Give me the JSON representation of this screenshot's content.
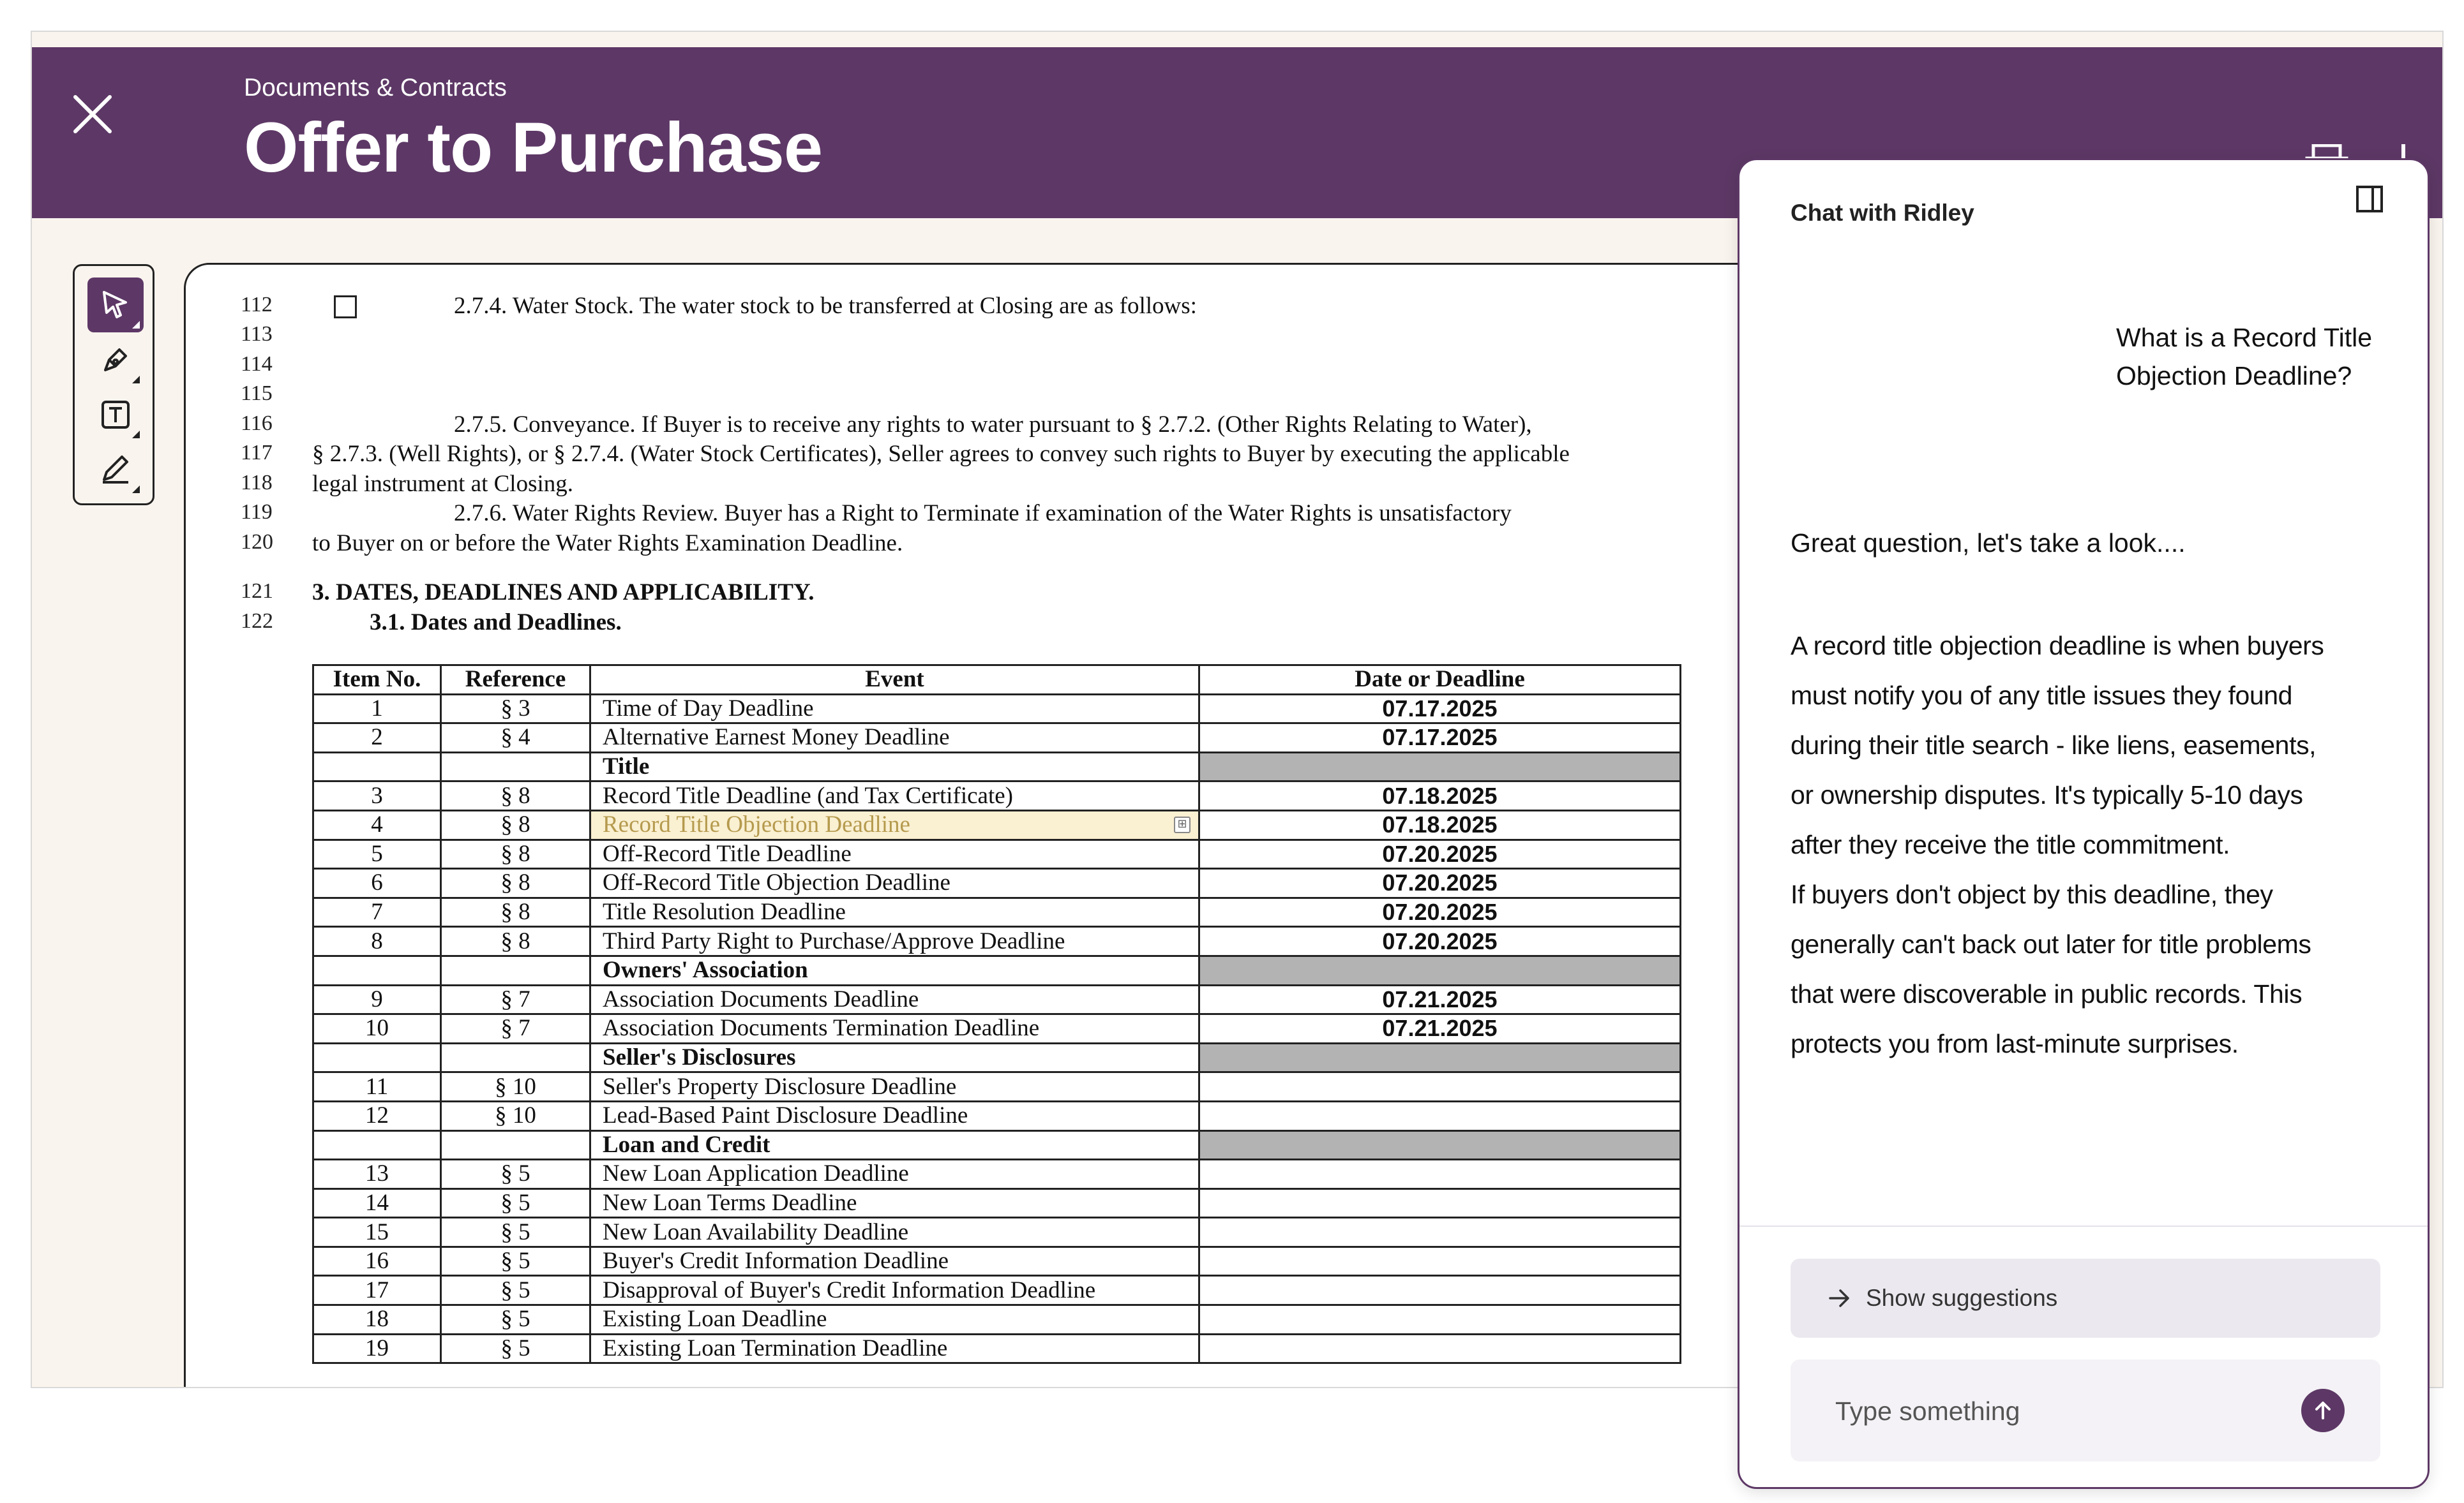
{
  "header": {
    "breadcrumb": "Documents & Contracts",
    "title": "Offer to Purchase"
  },
  "toolbar": {
    "tools": [
      "select-tool",
      "pen-tool",
      "text-tool",
      "highlight-tool"
    ],
    "active": "select-tool"
  },
  "document": {
    "lines": [
      {
        "num": "112",
        "text": "2.7.4.    Water Stock.  The water stock to be transferred at Closing are as follows:"
      },
      {
        "num": "113",
        "text": ""
      },
      {
        "num": "114",
        "text": ""
      },
      {
        "num": "115",
        "text": ""
      },
      {
        "num": "116",
        "text": "2.7.5.    Conveyance.  If Buyer is to receive any rights to water pursuant to § 2.7.2. (Other Rights Relating to Water),"
      },
      {
        "num": "117",
        "text": "§ 2.7.3. (Well Rights), or § 2.7.4. (Water Stock Certificates), Seller agrees to convey such rights to Buyer by executing the applicable"
      },
      {
        "num": "118",
        "text": "legal instrument at Closing."
      },
      {
        "num": "119",
        "text": "2.7.6.    Water Rights Review.  Buyer has a Right to Terminate if examination of the Water Rights is unsatisfactory"
      },
      {
        "num": "120",
        "text": "to Buyer on or before the Water Rights Examination Deadline."
      },
      {
        "num": "121",
        "text": "3.    DATES, DEADLINES AND APPLICABILITY."
      },
      {
        "num": "122",
        "text": "3.1.    Dates and Deadlines."
      }
    ],
    "table": {
      "headers": [
        "Item No.",
        "Reference",
        "Event",
        "Date or Deadline"
      ],
      "rows": [
        {
          "item": "1",
          "ref": "§ 3",
          "event": "Time of Day Deadline",
          "date": "07.17.2025"
        },
        {
          "item": "2",
          "ref": "§ 4",
          "event": "Alternative Earnest Money Deadline",
          "date": "07.17.2025"
        },
        {
          "item": "",
          "ref": "",
          "event": "Title",
          "date": "",
          "section": true
        },
        {
          "item": "3",
          "ref": "§ 8",
          "event": "Record Title Deadline (and Tax Certificate)",
          "date": "07.18.2025"
        },
        {
          "item": "4",
          "ref": "§ 8",
          "event": "Record Title Objection Deadline",
          "date": "07.18.2025",
          "highlight": true
        },
        {
          "item": "5",
          "ref": "§ 8",
          "event": "Off-Record Title Deadline",
          "date": "07.20.2025"
        },
        {
          "item": "6",
          "ref": "§ 8",
          "event": "Off-Record Title Objection Deadline",
          "date": "07.20.2025"
        },
        {
          "item": "7",
          "ref": "§ 8",
          "event": "Title Resolution Deadline",
          "date": "07.20.2025"
        },
        {
          "item": "8",
          "ref": "§ 8",
          "event": "Third Party Right to Purchase/Approve Deadline",
          "date": "07.20.2025"
        },
        {
          "item": "",
          "ref": "",
          "event": "Owners' Association",
          "date": "",
          "section": true
        },
        {
          "item": "9",
          "ref": "§ 7",
          "event": "Association Documents Deadline",
          "date": "07.21.2025"
        },
        {
          "item": "10",
          "ref": "§ 7",
          "event": "Association Documents Termination Deadline",
          "date": "07.21.2025"
        },
        {
          "item": "",
          "ref": "",
          "event": "Seller's Disclosures",
          "date": "",
          "section": true
        },
        {
          "item": "11",
          "ref": "§ 10",
          "event": "Seller's Property Disclosure Deadline",
          "date": ""
        },
        {
          "item": "12",
          "ref": "§ 10",
          "event": "Lead-Based Paint Disclosure Deadline",
          "date": ""
        },
        {
          "item": "",
          "ref": "",
          "event": "Loan and Credit",
          "date": "",
          "section": true
        },
        {
          "item": "13",
          "ref": "§ 5",
          "event": "New Loan Application Deadline",
          "date": ""
        },
        {
          "item": "14",
          "ref": "§ 5",
          "event": "New Loan Terms Deadline",
          "date": ""
        },
        {
          "item": "15",
          "ref": "§ 5",
          "event": "New Loan Availability Deadline",
          "date": ""
        },
        {
          "item": "16",
          "ref": "§ 5",
          "event": "Buyer's Credit Information Deadline",
          "date": ""
        },
        {
          "item": "17",
          "ref": "§ 5",
          "event": "Disapproval of Buyer's Credit Information Deadline",
          "date": ""
        },
        {
          "item": "18",
          "ref": "§ 5",
          "event": "Existing Loan Deadline",
          "date": ""
        },
        {
          "item": "19",
          "ref": "§ 5",
          "event": "Existing Loan Termination Deadline",
          "date": ""
        }
      ]
    }
  },
  "chat": {
    "title": "Chat with Ridley",
    "user_message": "What is a Record Title Objection Deadline?",
    "bot_greeting": "Great question, let's take a look....",
    "bot_answer_p1": "A record title objection deadline is when buyers must notify you of any title issues they found during their title search - like liens, easements, or ownership disputes. It's typically 5-10 days after they receive the title commitment.",
    "bot_answer_p2": "If buyers don't object by this deadline, they generally can't back out later for title problems that were discoverable in public records. This protects you from last-minute surprises.",
    "suggestions_label": "Show suggestions",
    "input_placeholder": "Type something"
  },
  "colors": {
    "brand": "#5d3866",
    "highlight": "#faf0d2",
    "section_gray": "#b3b3b3"
  }
}
